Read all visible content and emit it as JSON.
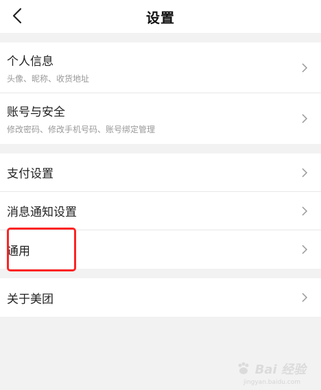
{
  "header": {
    "title": "设置",
    "back_icon": "chevron-left-icon"
  },
  "groups": [
    {
      "items": [
        {
          "title": "个人信息",
          "subtitle": "头像、昵称、收货地址"
        },
        {
          "title": "账号与安全",
          "subtitle": "修改密码、修改手机号码、账号绑定管理"
        }
      ]
    },
    {
      "items": [
        {
          "title": "支付设置"
        },
        {
          "title": "消息通知设置"
        },
        {
          "title": "通用"
        }
      ]
    },
    {
      "items": [
        {
          "title": "关于美团"
        }
      ]
    }
  ],
  "annotation": {
    "color": "#ff2222"
  },
  "watermark": {
    "text": "Bai 经验",
    "url": "jingyan.baidu.com"
  }
}
